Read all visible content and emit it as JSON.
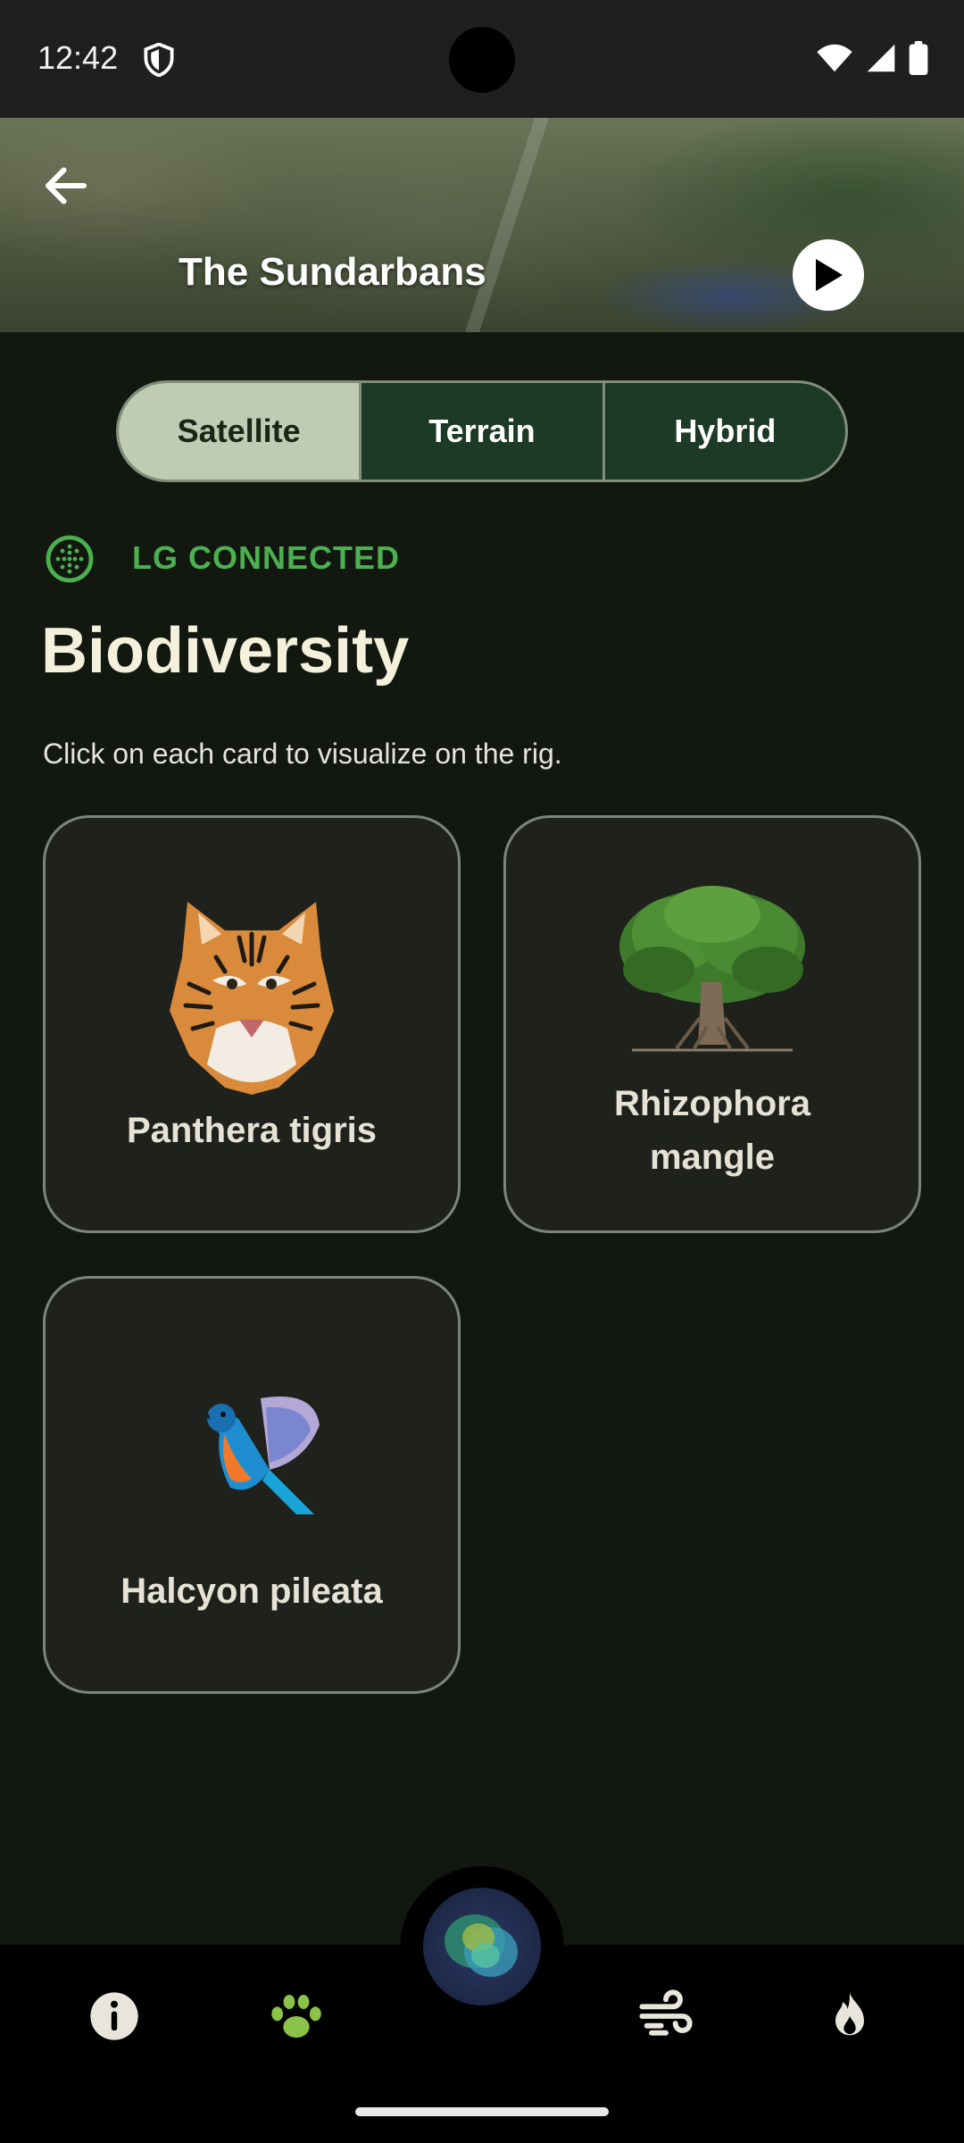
{
  "status_bar": {
    "time": "12:42"
  },
  "header": {
    "title": "The Sundarbans"
  },
  "map_type_selector": {
    "options": [
      "Satellite",
      "Terrain",
      "Hybrid"
    ],
    "selected": "Satellite"
  },
  "connection": {
    "status_text": "LG CONNECTED",
    "color": "#4caf50"
  },
  "section": {
    "title": "Biodiversity",
    "subtitle": "Click on each card to visualize on the rig."
  },
  "cards": [
    {
      "label": "Panthera tigris",
      "icon": "tiger-icon"
    },
    {
      "label": "Rhizophora mangle",
      "label_line1": "Rhizophora",
      "label_line2": "mangle",
      "icon": "mangrove-tree-icon"
    },
    {
      "label": "Halcyon pileata",
      "icon": "kingfisher-icon"
    }
  ],
  "bottom_nav": {
    "items": [
      {
        "icon": "info-icon",
        "active": false
      },
      {
        "icon": "paw-icon",
        "active": true
      },
      {
        "icon": "orb-icon",
        "active": false
      },
      {
        "icon": "wind-icon",
        "active": false
      },
      {
        "icon": "fire-icon",
        "active": false
      }
    ],
    "active_color": "#8bc34a"
  }
}
